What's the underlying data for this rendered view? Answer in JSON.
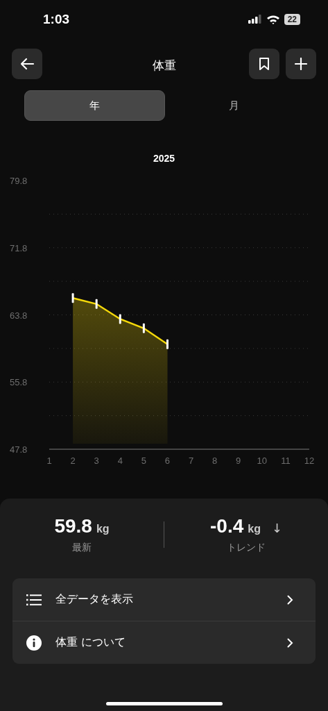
{
  "status_bar": {
    "time": "1:03",
    "battery": "22"
  },
  "header": {
    "title": "体重"
  },
  "tabs": [
    {
      "label": "年",
      "selected": true
    },
    {
      "label": "月",
      "selected": false
    }
  ],
  "chart": {
    "chart_data": {
      "type": "area",
      "title": "2025",
      "x": [
        2,
        3,
        4,
        5,
        6
      ],
      "grid": true,
      "series": [
        {
          "color": "#f5d90a",
          "values": [
            65.8,
            65.1,
            63.3,
            62.2,
            60.3
          ]
        }
      ],
      "xlim": [
        1,
        12
      ],
      "ylim": [
        47.8,
        79.8
      ],
      "xticks": [
        1,
        2,
        3,
        4,
        5,
        6,
        7,
        8,
        9,
        10,
        11,
        12
      ],
      "yticks": [
        47.8,
        55.8,
        63.8,
        71.8,
        79.8
      ]
    }
  },
  "stats": [
    {
      "value": "59.8",
      "unit": "kg",
      "label": "最新"
    },
    {
      "value": "-0.4",
      "unit": "kg",
      "trend": "↓",
      "label": "トレンド"
    }
  ],
  "menu": [
    {
      "kind": "list",
      "label": "全データを表示"
    },
    {
      "kind": "info",
      "label": "体重 について"
    }
  ]
}
